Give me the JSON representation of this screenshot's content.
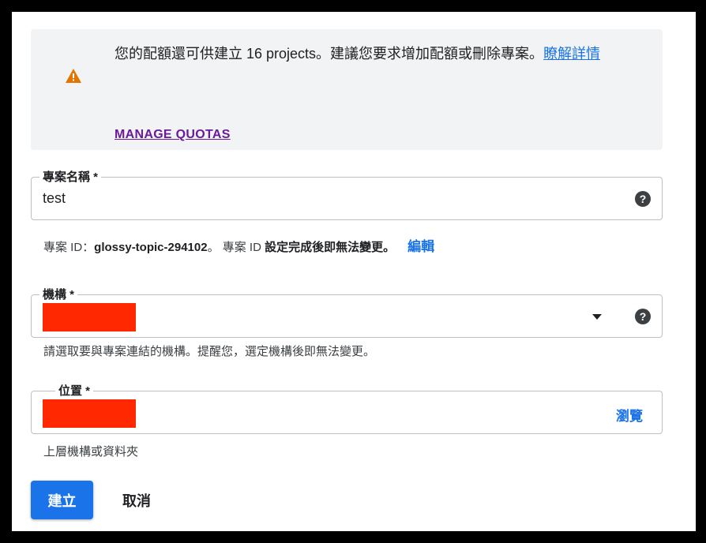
{
  "quota_notice": {
    "message": "您的配額還可供建立 16 projects。建議您要求增加配額或刪除專案。",
    "learn_more_link": "瞭解詳情",
    "manage_quotas_label": "MANAGE QUOTAS"
  },
  "project_name": {
    "label": "專案名稱 *",
    "value": "test"
  },
  "project_id_info": {
    "prefix": "專案 ID：",
    "id_value": "glossy-topic-294102",
    "middle": "。 專案 ID ",
    "warning": "設定完成後即無法變更。",
    "edit_link": "編輯"
  },
  "organization": {
    "label": "機構 *",
    "hint": "請選取要與專案連結的機構。提醒您，選定機構後即無法變更。"
  },
  "location": {
    "label": "位置 *",
    "browse_label": "瀏覽",
    "hint": "上層機構或資料夾"
  },
  "actions": {
    "create_label": "建立",
    "cancel_label": "取消"
  },
  "colors": {
    "accent": "#1a73e8",
    "warning": "#e37400",
    "manage_quotas": "#6a1b9a",
    "redaction": "#ff2800"
  },
  "icons": {
    "warning": "warning-icon",
    "help": "help-icon",
    "dropdown": "dropdown-arrow-icon"
  }
}
